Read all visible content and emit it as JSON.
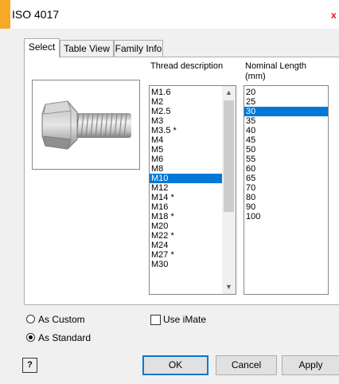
{
  "window": {
    "title": "ISO 4017",
    "close_glyph": "x"
  },
  "tabs": [
    {
      "label": "Select",
      "active": true
    },
    {
      "label": "Table View",
      "active": false
    },
    {
      "label": "Family Info",
      "active": false
    }
  ],
  "preview": {
    "icon": "hex-bolt-preview-image"
  },
  "thread": {
    "header": "Thread description",
    "items": [
      "M1.6",
      "M2",
      "M2.5",
      "M3",
      "M3.5 *",
      "M4",
      "M5",
      "M6",
      "M8",
      "M10",
      "M12",
      "M14 *",
      "M16",
      "M18 *",
      "M20",
      "M22 *",
      "M24",
      "M27 *",
      "M30"
    ],
    "selected": "M10",
    "scroll_up_icon": "chevron-up-icon",
    "scroll_down_icon": "chevron-down-icon"
  },
  "nominal": {
    "header_line1": "Nominal Length",
    "header_line2": "(mm)",
    "items": [
      "20",
      "25",
      "30",
      "35",
      "40",
      "45",
      "50",
      "55",
      "60",
      "65",
      "70",
      "80",
      "90",
      "100"
    ],
    "selected": "30"
  },
  "options": {
    "as_custom": "As Custom",
    "as_standard": "As Standard",
    "selected": "As Standard",
    "use_imate": "Use iMate",
    "use_imate_checked": false
  },
  "buttons": {
    "help": "?",
    "ok": "OK",
    "cancel": "Cancel",
    "apply": "Apply"
  },
  "colors": {
    "accent": "#f7a928",
    "selection": "#0078d7",
    "close": "#e81123"
  }
}
